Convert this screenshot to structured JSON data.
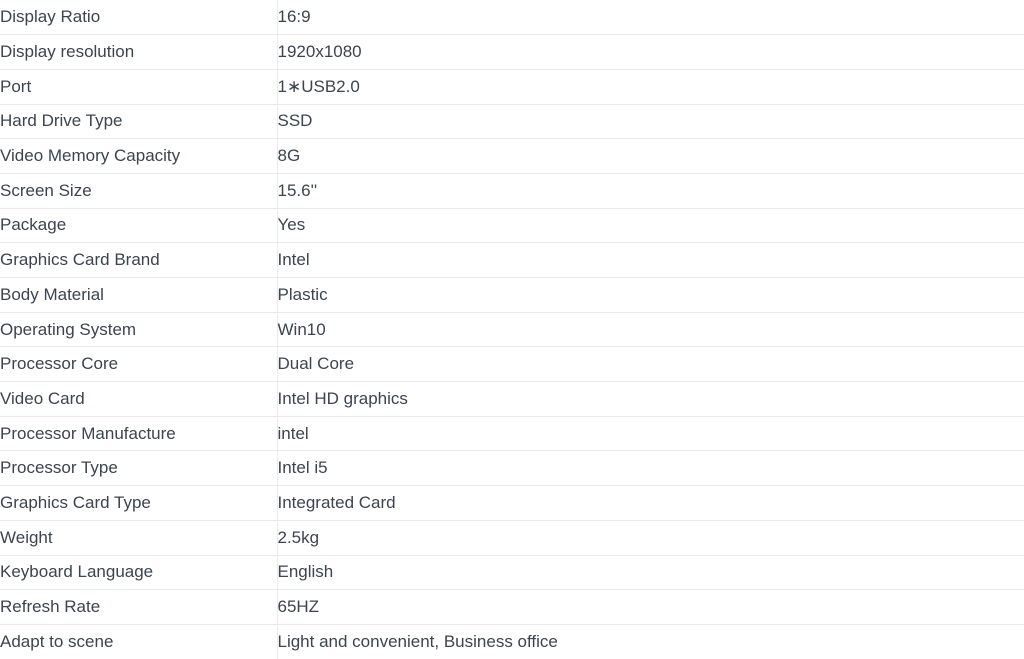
{
  "table": {
    "columns": [
      "name",
      "value"
    ],
    "rows": [
      {
        "name": "Display Ratio",
        "value": "16:9"
      },
      {
        "name": "Display resolution",
        "value": "1920x1080"
      },
      {
        "name": "Port",
        "value": "1∗USB2.0"
      },
      {
        "name": "Hard Drive Type",
        "value": "SSD"
      },
      {
        "name": "Video Memory Capacity",
        "value": "8G"
      },
      {
        "name": "Screen Size",
        "value": "15.6''"
      },
      {
        "name": "Package",
        "value": "Yes"
      },
      {
        "name": "Graphics Card Brand",
        "value": "Intel"
      },
      {
        "name": "Body Material",
        "value": "Plastic"
      },
      {
        "name": "Operating System",
        "value": "Win10"
      },
      {
        "name": "Processor Core",
        "value": "Dual Core"
      },
      {
        "name": "Video Card",
        "value": "Intel HD graphics"
      },
      {
        "name": "Processor Manufacture",
        "value": "intel"
      },
      {
        "name": "Processor Type",
        "value": "Intel i5"
      },
      {
        "name": "Graphics Card Type",
        "value": "Integrated Card"
      },
      {
        "name": "Weight",
        "value": "2.5kg"
      },
      {
        "name": "Keyboard Language",
        "value": "English"
      },
      {
        "name": "Refresh Rate",
        "value": "65HZ"
      },
      {
        "name": "Adapt to scene",
        "value": "Light and convenient, Business office"
      }
    ]
  },
  "colors": {
    "text": "#3c4450",
    "rule": "#ebebeb",
    "background": "#ffffff"
  }
}
